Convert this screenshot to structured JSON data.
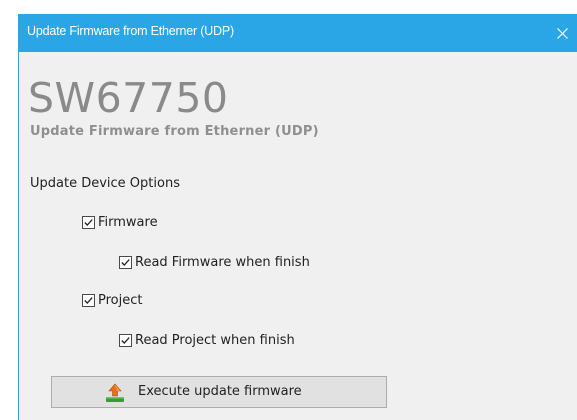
{
  "window": {
    "title": "Update Firmware from Etherner (UDP)"
  },
  "header": {
    "product_code": "SW67750",
    "subtitle": "Update Firmware from Etherner (UDP)"
  },
  "options": {
    "section_label": "Update Device Options",
    "items": [
      {
        "label": "Firmware",
        "checked": true
      },
      {
        "label": "Read Firmware when finish",
        "checked": true
      },
      {
        "label": "Project",
        "checked": true
      },
      {
        "label": "Read Project when finish",
        "checked": true
      }
    ]
  },
  "actions": {
    "execute_label": "Execute update firmware",
    "execute_icon": "upload-chip-icon"
  },
  "colors": {
    "titlebar": "#2aa6e6",
    "background": "#f0f0f0",
    "product_code": "#8a8a8a"
  }
}
